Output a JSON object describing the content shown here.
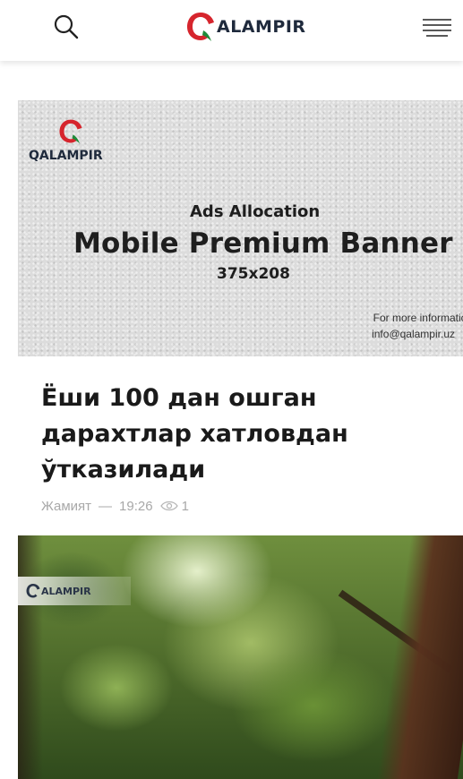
{
  "header": {
    "logo_text": "ALAMPIR",
    "search_icon": "search-icon",
    "menu_icon": "hamburger-menu-icon",
    "brand_color": "#d6252d"
  },
  "ad": {
    "logo_text": "QALAMPIR",
    "label": "Ads Allocation",
    "title": "Mobile Premium Banner",
    "size": "375x208",
    "contact_line1": "For more information",
    "contact_line2": "info@qalampir.uz"
  },
  "article": {
    "title": "Ёши 100 дан ошган дарахтлар хатловдан ўтказилади",
    "category": "Жамият",
    "separator": "—",
    "time": "19:26",
    "views": "1",
    "views_icon": "eye-icon",
    "image_watermark": "ALAMPIR"
  }
}
